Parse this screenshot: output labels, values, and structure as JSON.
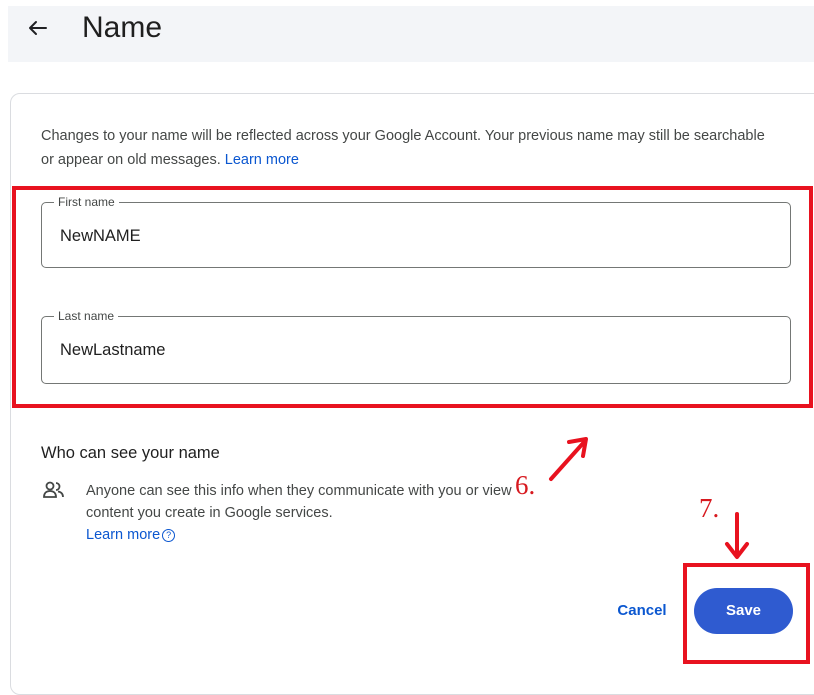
{
  "header": {
    "back_icon": "arrow-left-icon",
    "title": "Name",
    "background": "#f3f5f8"
  },
  "description": {
    "text": "Changes to your name will be reflected across your Google Account. Your previous name may still be searchable or appear on old messages.",
    "link": "Learn more"
  },
  "fields": {
    "first_name": {
      "label": "First name",
      "value": "NewNAME"
    },
    "last_name": {
      "label": "Last name",
      "value": "NewLastname"
    }
  },
  "visibility": {
    "title": "Who can see your name",
    "icon": "people-icon",
    "text": "Anyone can see this info when they communicate with you or view content you create in Google services.",
    "link": "Learn more",
    "help_icon": "help-circle-icon",
    "help_glyph": "?"
  },
  "actions": {
    "cancel": "Cancel",
    "save": "Save"
  },
  "annotations": {
    "step6": "6.",
    "step7": "7.",
    "color": "#e8121f"
  },
  "colors": {
    "accent": "#0b57d0",
    "save_button": "#2f5bd0",
    "annotation": "#e8121f"
  }
}
